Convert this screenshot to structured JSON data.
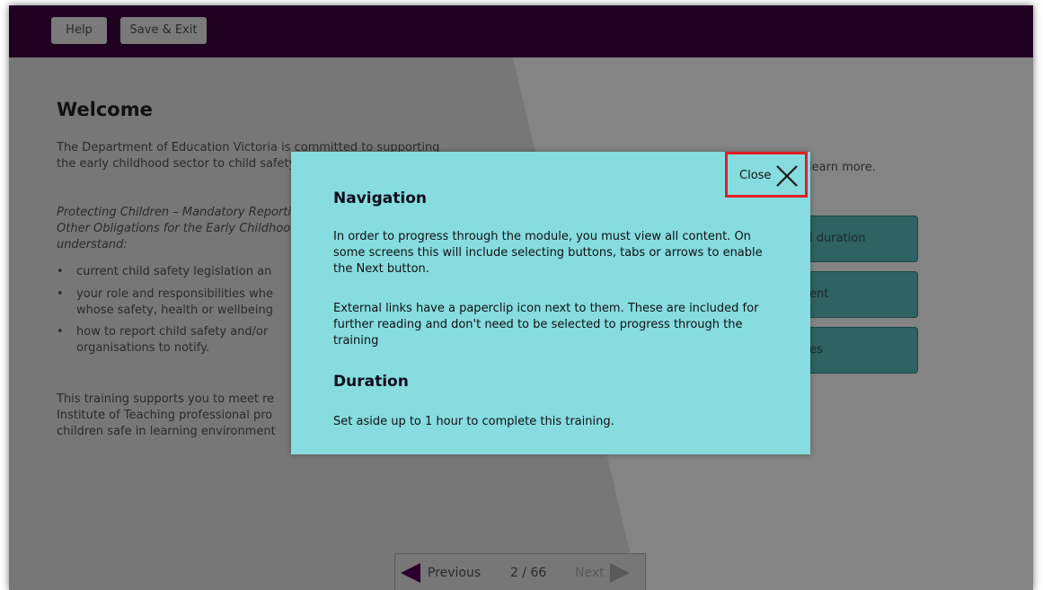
{
  "toolbar": {
    "help_label": "Help",
    "save_exit_label": "Save & Exit"
  },
  "welcome": {
    "title": "Welcome",
    "para1": "The Department of Education Victoria is committed to supporting the early childhood sector to child safety issues.",
    "para2": "Protecting Children – Mandatory Reporting and Other Obligations for the Early Childhood Sector understand:",
    "bullets": [
      "current child safety legislation an",
      "your role and responsibilities whe whose safety, health or wellbeing",
      "how to report child safety and/or organisations to notify."
    ],
    "para3": "This training supports you to meet re Institute of Teaching professional pro children safe in learning environment"
  },
  "right_panel": {
    "learn_more_text": "learn more.",
    "tiles": [
      "l duration",
      "ent",
      "es"
    ]
  },
  "pager": {
    "previous_label": "Previous",
    "page_count": "2 / 66",
    "next_label": "Next"
  },
  "modal": {
    "close_label": "Close",
    "navigation_heading": "Navigation",
    "navigation_p1": "In order to progress through the module, you must view all content. On some screens this will include selecting buttons, tabs or arrows to enable the Next button.",
    "navigation_p2": "External links have a paperclip icon next to them. These are included for further reading and don't need to be selected to progress through the training",
    "duration_heading": "Duration",
    "duration_text": "Set aside up to 1 hour to complete this training."
  },
  "colors": {
    "top_bar": "#200020",
    "modal_bg": "#86dcdf",
    "highlight_border": "#e02020",
    "overlay_left": "#777777",
    "overlay_right": "#848484"
  }
}
